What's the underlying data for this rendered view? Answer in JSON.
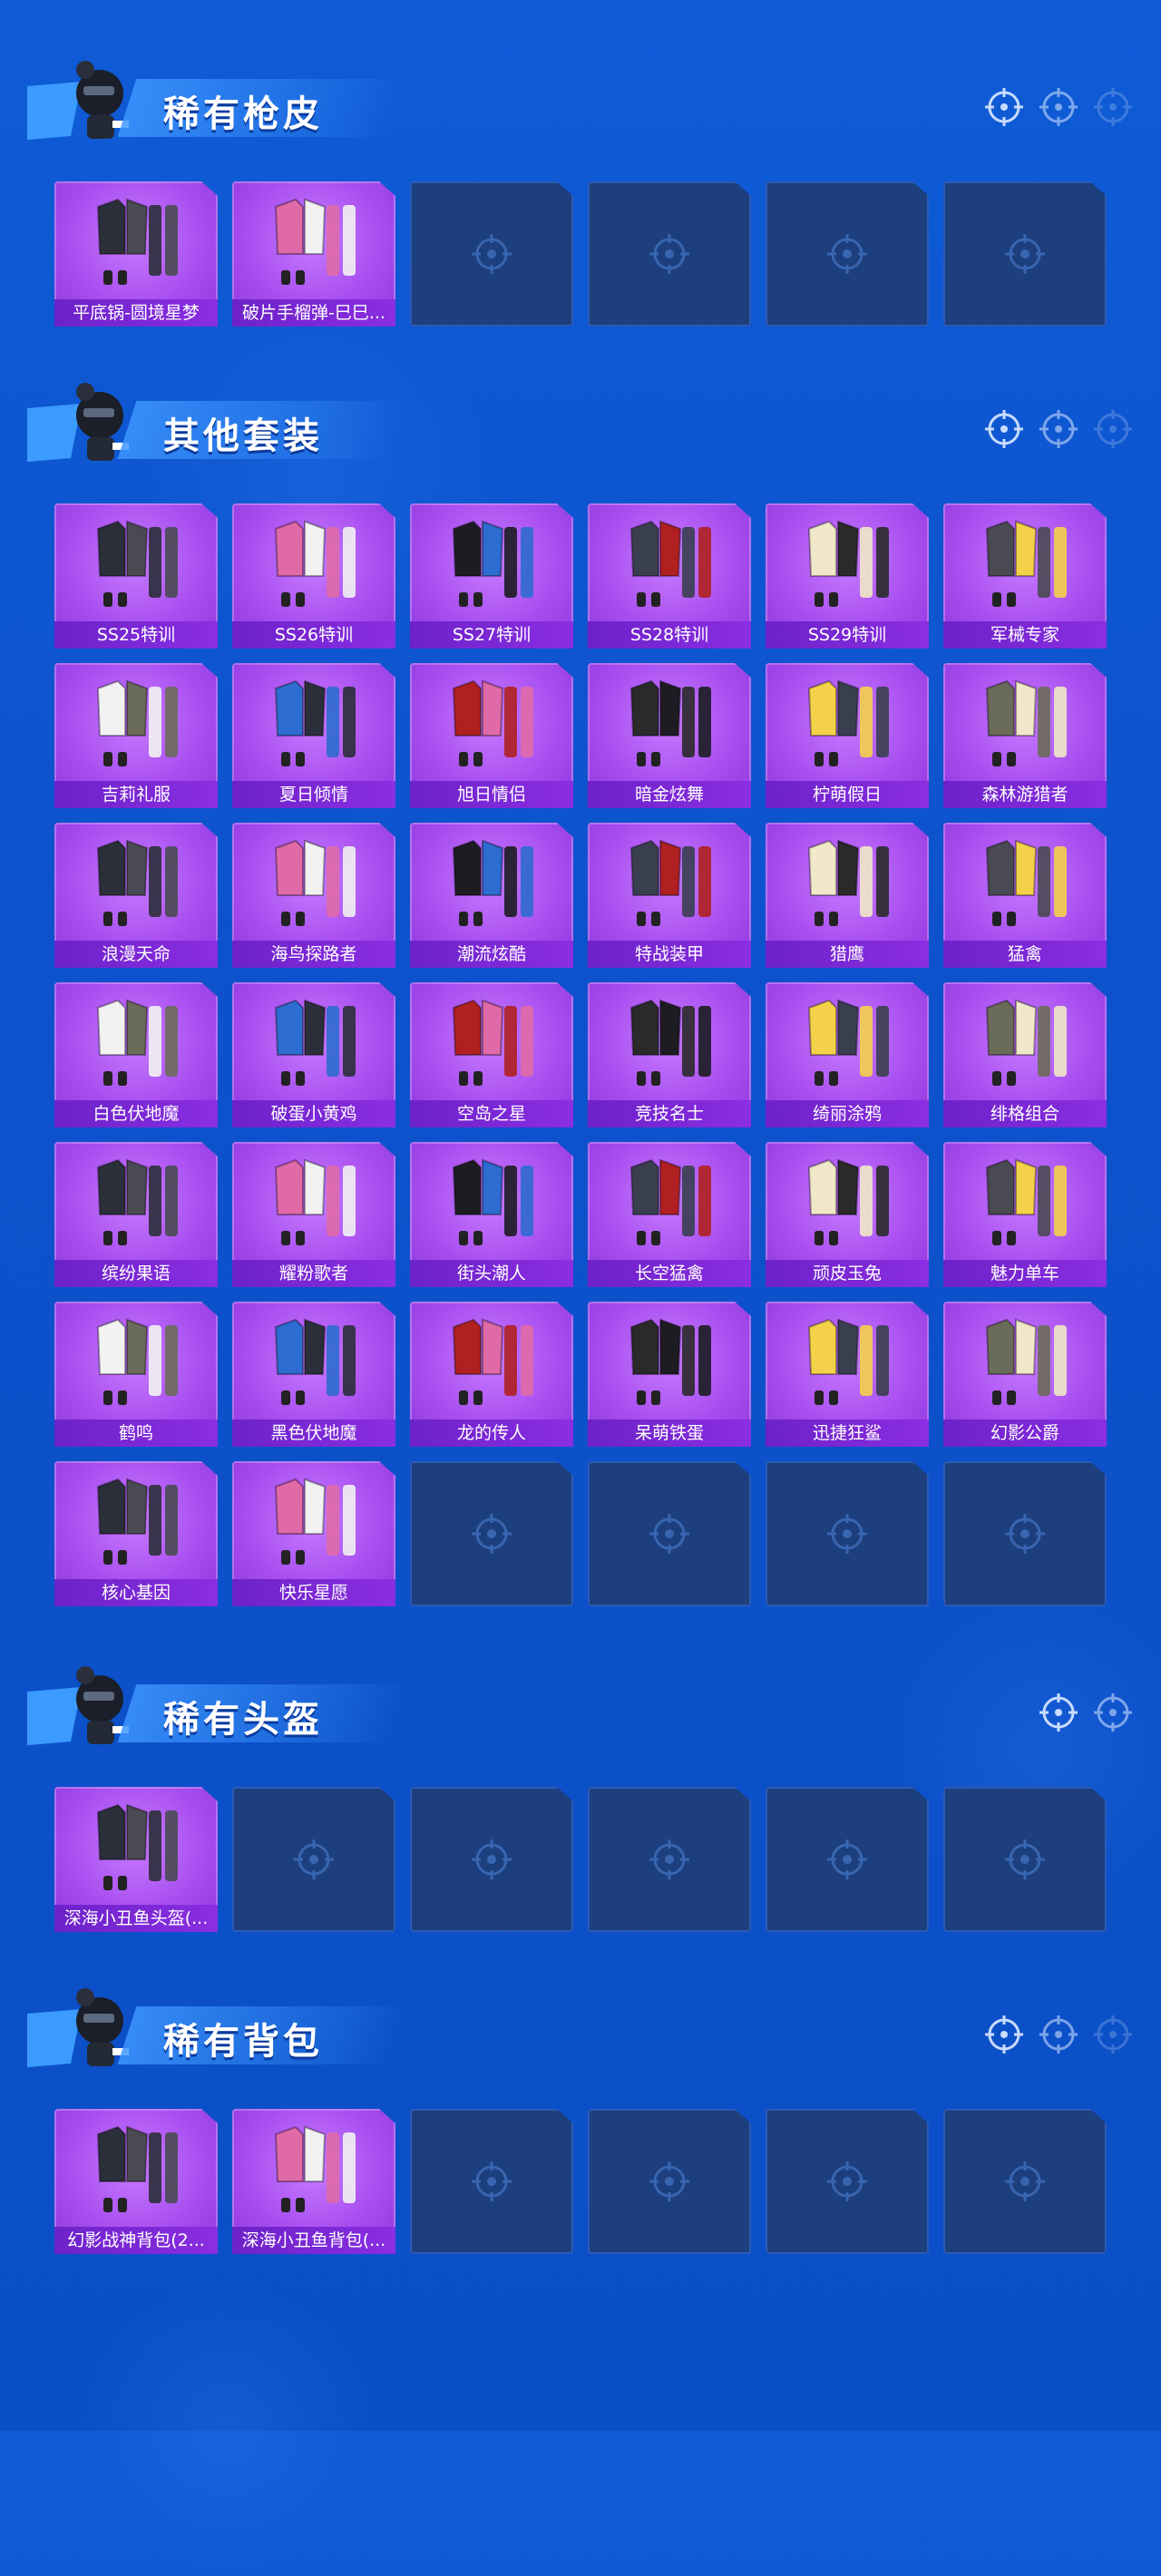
{
  "sections": {
    "rare_skins": {
      "title": "稀有枪皮",
      "items": [
        "平底锅-圆境星梦",
        "破片手榴弹-巳巳..."
      ],
      "empty_slots": 4
    },
    "other_sets": {
      "title": "其他套装",
      "items": [
        "SS25特训",
        "SS26特训",
        "SS27特训",
        "SS28特训",
        "SS29特训",
        "军械专家",
        "吉莉礼服",
        "夏日倾情",
        "旭日情侣",
        "暗金炫舞",
        "柠萌假日",
        "森林游猎者",
        "浪漫天命",
        "海鸟探路者",
        "潮流炫酷",
        "特战装甲",
        "猎鹰",
        "猛禽",
        "白色伏地魔",
        "破蛋小黄鸡",
        "空岛之星",
        "竞技名士",
        "绮丽涂鸦",
        "绯格组合",
        "缤纷果语",
        "耀粉歌者",
        "街头潮人",
        "长空猛禽",
        "顽皮玉兔",
        "魅力单车",
        "鹤鸣",
        "黑色伏地魔",
        "龙的传人",
        "呆萌铁蛋",
        "迅捷狂鲨",
        "幻影公爵",
        "核心基因",
        "快乐星愿"
      ],
      "empty_slots": 4
    },
    "rare_helmets": {
      "title": "稀有头盔",
      "items": [
        "深海小丑鱼头盔(..."
      ],
      "empty_slots": 5
    },
    "rare_backpacks": {
      "title": "稀有背包",
      "items": [
        "幻影战神背包(2...",
        "深海小丑鱼背包(..."
      ],
      "empty_slots": 4
    }
  },
  "icons": {
    "header_mascot": "soldier-mascot-icon",
    "header_deco": "crosshair-icon",
    "empty_slot": "crosshair-icon"
  },
  "colors": {
    "background": "#0f5bd6",
    "card_purple": "#a94ff0",
    "label_purple": "#7a28d6",
    "empty_slot": "#1d3f7e"
  }
}
